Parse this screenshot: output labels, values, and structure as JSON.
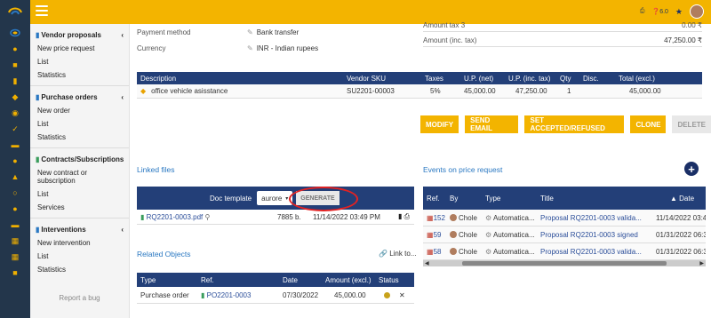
{
  "header": {
    "help_label": "6.0"
  },
  "sidebar": {
    "groups": [
      {
        "title": "Vendor proposals",
        "items": [
          "New price request",
          "List",
          "Statistics"
        ]
      },
      {
        "title": "Purchase orders",
        "items": [
          "New order",
          "List",
          "Statistics"
        ]
      },
      {
        "title": "Contracts/Subscriptions",
        "items": [
          "New contract or subscription",
          "List",
          "Services"
        ]
      },
      {
        "title": "Interventions",
        "items": [
          "New intervention",
          "List",
          "Statistics"
        ]
      }
    ],
    "report_bug": "Report a bug"
  },
  "details": {
    "payment_method_label": "Payment method",
    "payment_method_value": "Bank transfer",
    "currency_label": "Currency",
    "currency_value": "INR - Indian rupees",
    "amount_tax3_label": "Amount tax 3",
    "amount_tax3_value": "0.00 ₹",
    "amount_inc_label": "Amount (inc. tax)",
    "amount_inc_value": "47,250.00 ₹"
  },
  "lines": {
    "headers": [
      "Description",
      "Vendor SKU",
      "Taxes",
      "U.P. (net)",
      "U.P. (inc. tax)",
      "Qty",
      "Disc.",
      "Total (excl.)"
    ],
    "rows": [
      {
        "description": "office vehicle asisstance",
        "sku": "SU2201-00003",
        "taxes": "5%",
        "up_net": "45,000.00",
        "up_inc": "47,250.00",
        "qty": "1",
        "disc": "",
        "total": "45,000.00"
      }
    ]
  },
  "actions": {
    "modify": "MODIFY",
    "send_email": "SEND EMAIL",
    "set_accepted": "SET ACCEPTED/REFUSED",
    "clone": "CLONE",
    "delete": "DELETE"
  },
  "linked_files": {
    "title": "Linked files",
    "doc_template_label": "Doc template",
    "template_value": "aurore",
    "generate_label": "GENERATE",
    "files": [
      {
        "name": "RQ2201-0003.pdf",
        "size": "7885 b.",
        "date": "11/14/2022 03:49 PM"
      }
    ]
  },
  "related": {
    "title": "Related Objects",
    "link_to": "Link to...",
    "headers": [
      "Type",
      "Ref.",
      "Date",
      "Amount (excl.)",
      "Status"
    ],
    "rows": [
      {
        "type": "Purchase order",
        "ref": "PO2201-0003",
        "date": "07/30/2022",
        "amount": "45,000.00"
      }
    ]
  },
  "events": {
    "title": "Events on price request",
    "headers": [
      "Ref.",
      "By",
      "Type",
      "Title",
      "▲ Date"
    ],
    "rows": [
      {
        "ref": "152",
        "by": "Chole",
        "type": "Automatica...",
        "title": "Proposal RQ2201-0003 valida...",
        "date": "11/14/2022 03:49 P"
      },
      {
        "ref": "59",
        "by": "Chole",
        "type": "Automatica...",
        "title": "Proposal RQ2201-0003 signed",
        "date": "01/31/2022 06:39 P"
      },
      {
        "ref": "58",
        "by": "Chole",
        "type": "Automatica...",
        "title": "Proposal RQ2201-0003 valida...",
        "date": "01/31/2022 06:39 P"
      }
    ]
  },
  "colors": {
    "accent": "#f3b400",
    "navy": "#233f78",
    "link": "#2a78c2"
  }
}
